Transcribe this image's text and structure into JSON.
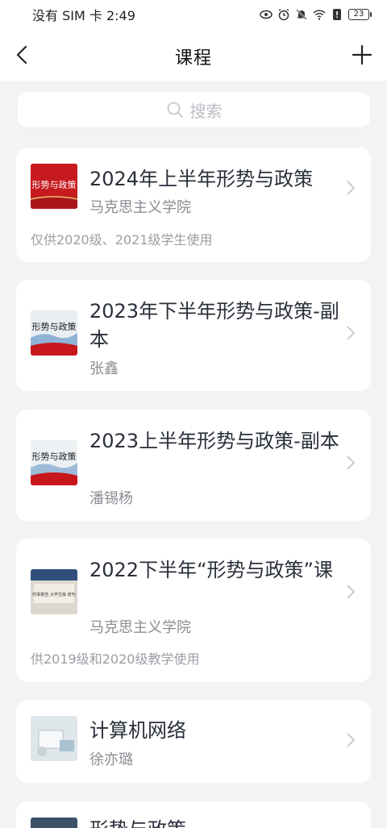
{
  "status": {
    "carrier_time": "没有 SIM 卡 2:49",
    "battery": "23"
  },
  "nav": {
    "title": "课程"
  },
  "search": {
    "placeholder": "搜索"
  },
  "courses": [
    {
      "title": "2024年上半年形势与政策",
      "subtitle": "马克思主义学院",
      "note": "仅供2020级、2021级学生使用",
      "thumb_text": "形势与政策"
    },
    {
      "title": "2023年下半年形势与政策-副本",
      "subtitle": "张鑫",
      "note": "",
      "thumb_text": "形势与政策"
    },
    {
      "title": "2023上半年形势与政策-副本",
      "subtitle": "潘锡杨",
      "note": "",
      "thumb_text": "形势与政策"
    },
    {
      "title": "2022下半年“形势与政策”课",
      "subtitle": "马克思主义学院",
      "note": "供2019级和2020级教学使用",
      "thumb_text": "时事报告 大学生版 增刊"
    },
    {
      "title": "计算机网络",
      "subtitle": "徐亦璐",
      "note": "",
      "thumb_text": ""
    },
    {
      "title": "形势与政策",
      "subtitle": "",
      "note": "",
      "thumb_text": ""
    }
  ]
}
